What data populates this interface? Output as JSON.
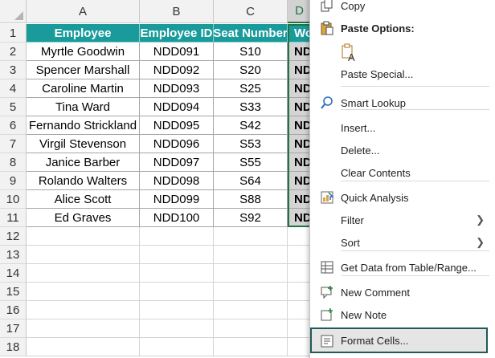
{
  "sheet": {
    "columns": [
      "A",
      "B",
      "C",
      "D"
    ],
    "rows": [
      "1",
      "2",
      "3",
      "4",
      "5",
      "6",
      "7",
      "8",
      "9",
      "10",
      "11",
      "12",
      "13",
      "14",
      "15",
      "16",
      "17",
      "18"
    ],
    "headers": [
      "Employee",
      "Employee ID",
      "Seat Number",
      "Wo"
    ],
    "data": [
      [
        "Myrtle Goodwin",
        "NDD091",
        "S10",
        "ND"
      ],
      [
        "Spencer Marshall",
        "NDD092",
        "S20",
        "ND"
      ],
      [
        "Caroline Martin",
        "NDD093",
        "S25",
        "ND"
      ],
      [
        "Tina Ward",
        "NDD094",
        "S33",
        "ND"
      ],
      [
        "Fernando Strickland",
        "NDD095",
        "S42",
        "ND"
      ],
      [
        "Virgil Stevenson",
        "NDD096",
        "S53",
        "ND"
      ],
      [
        "Janice Barber",
        "NDD097",
        "S55",
        "ND"
      ],
      [
        "Rolando Walters",
        "NDD098",
        "S64",
        "ND"
      ],
      [
        "Alice Scott",
        "NDD099",
        "S88",
        "ND"
      ],
      [
        "Ed Graves",
        "NDD100",
        "S92",
        "ND"
      ]
    ],
    "header_color": "#1a9b9b",
    "selection_color": "#217346"
  },
  "context_menu": {
    "copy": "Copy",
    "paste_options": "Paste Options:",
    "paste_special": "Paste Special...",
    "smart_lookup": "Smart Lookup",
    "insert": "Insert...",
    "delete": "Delete...",
    "clear_contents": "Clear Contents",
    "quick_analysis": "Quick Analysis",
    "filter": "Filter",
    "sort": "Sort",
    "get_data": "Get Data from Table/Range...",
    "new_comment": "New Comment",
    "new_note": "New Note",
    "format_cells": "Format Cells...",
    "highlight_color": "#1e5a5a"
  }
}
